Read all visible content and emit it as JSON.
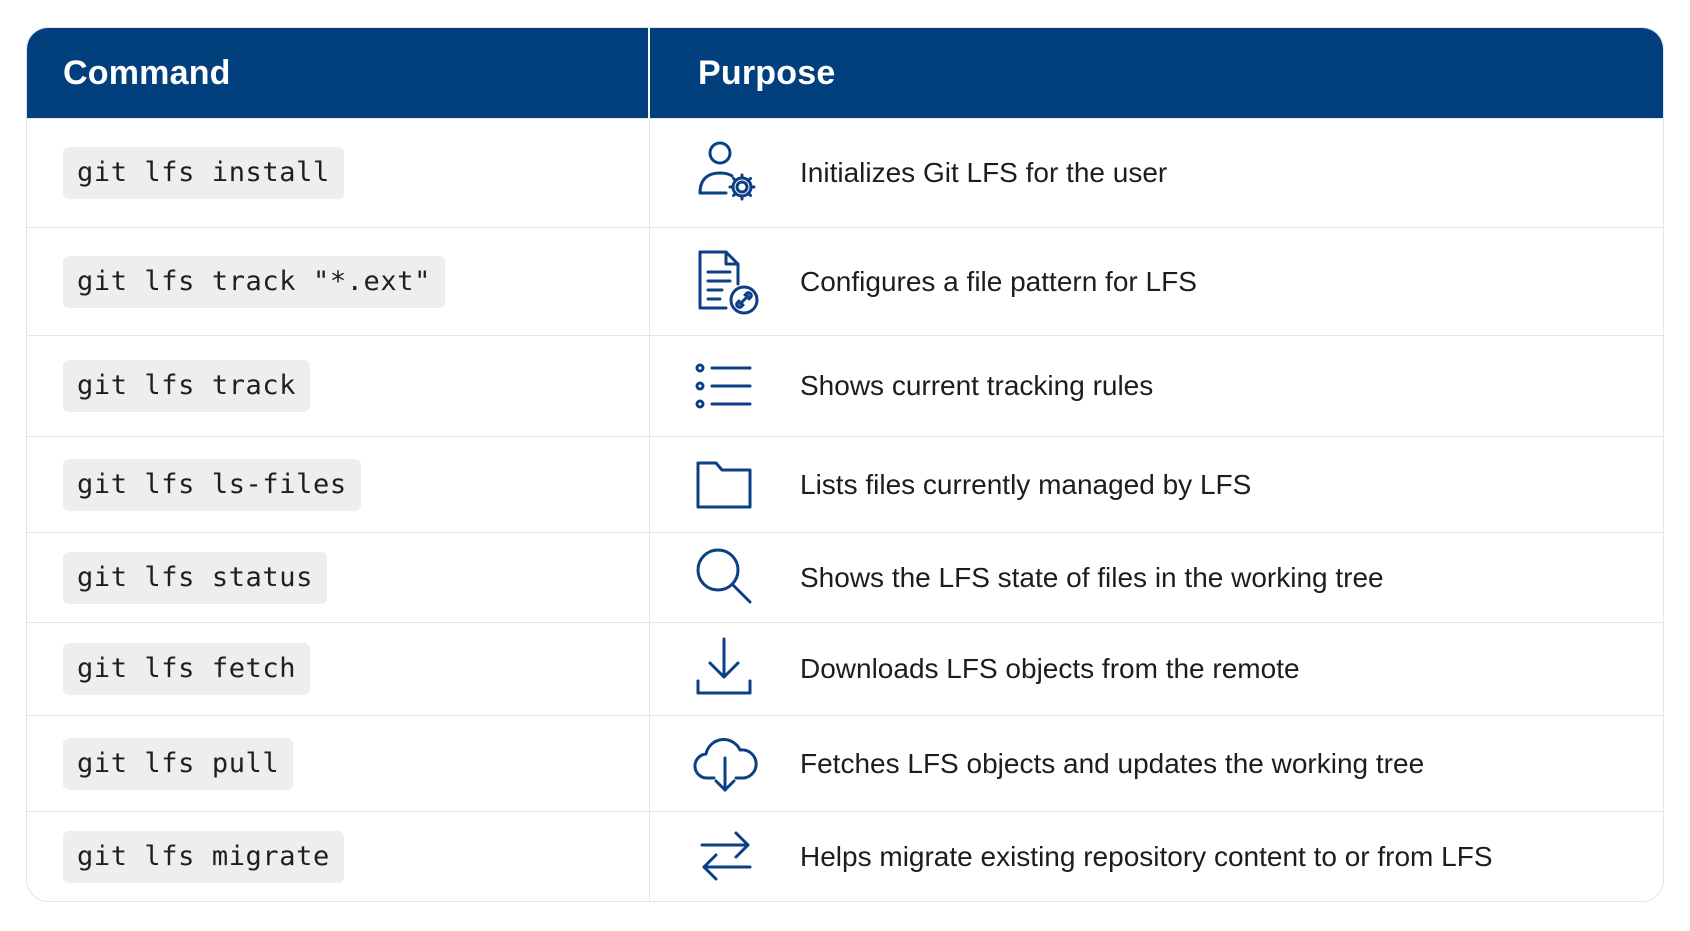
{
  "table": {
    "headers": {
      "command": "Command",
      "purpose": "Purpose"
    },
    "rows": [
      {
        "command": "git lfs install",
        "icon": "user-gear-icon",
        "purpose": "Initializes Git LFS for the user"
      },
      {
        "command": "git lfs track \"*.ext\"",
        "icon": "file-link-icon",
        "purpose": "Configures a file pattern for LFS"
      },
      {
        "command": "git lfs track",
        "icon": "list-icon",
        "purpose": "Shows current tracking rules"
      },
      {
        "command": "git lfs ls-files",
        "icon": "folder-icon",
        "purpose": "Lists files currently managed by LFS"
      },
      {
        "command": "git lfs status",
        "icon": "search-icon",
        "purpose": "Shows the LFS state of files in the working tree"
      },
      {
        "command": "git lfs fetch",
        "icon": "download-icon",
        "purpose": "Downloads LFS objects from the remote"
      },
      {
        "command": "git lfs pull",
        "icon": "cloud-download-icon",
        "purpose": "Fetches LFS objects and updates the working tree"
      },
      {
        "command": "git lfs migrate",
        "icon": "arrows-exchange-icon",
        "purpose": "Helps migrate existing repository content to or from LFS"
      }
    ]
  },
  "colors": {
    "header_background": "#023f7d",
    "icon_stroke": "#0b3f86",
    "code_chip_background": "#eeeeee"
  }
}
